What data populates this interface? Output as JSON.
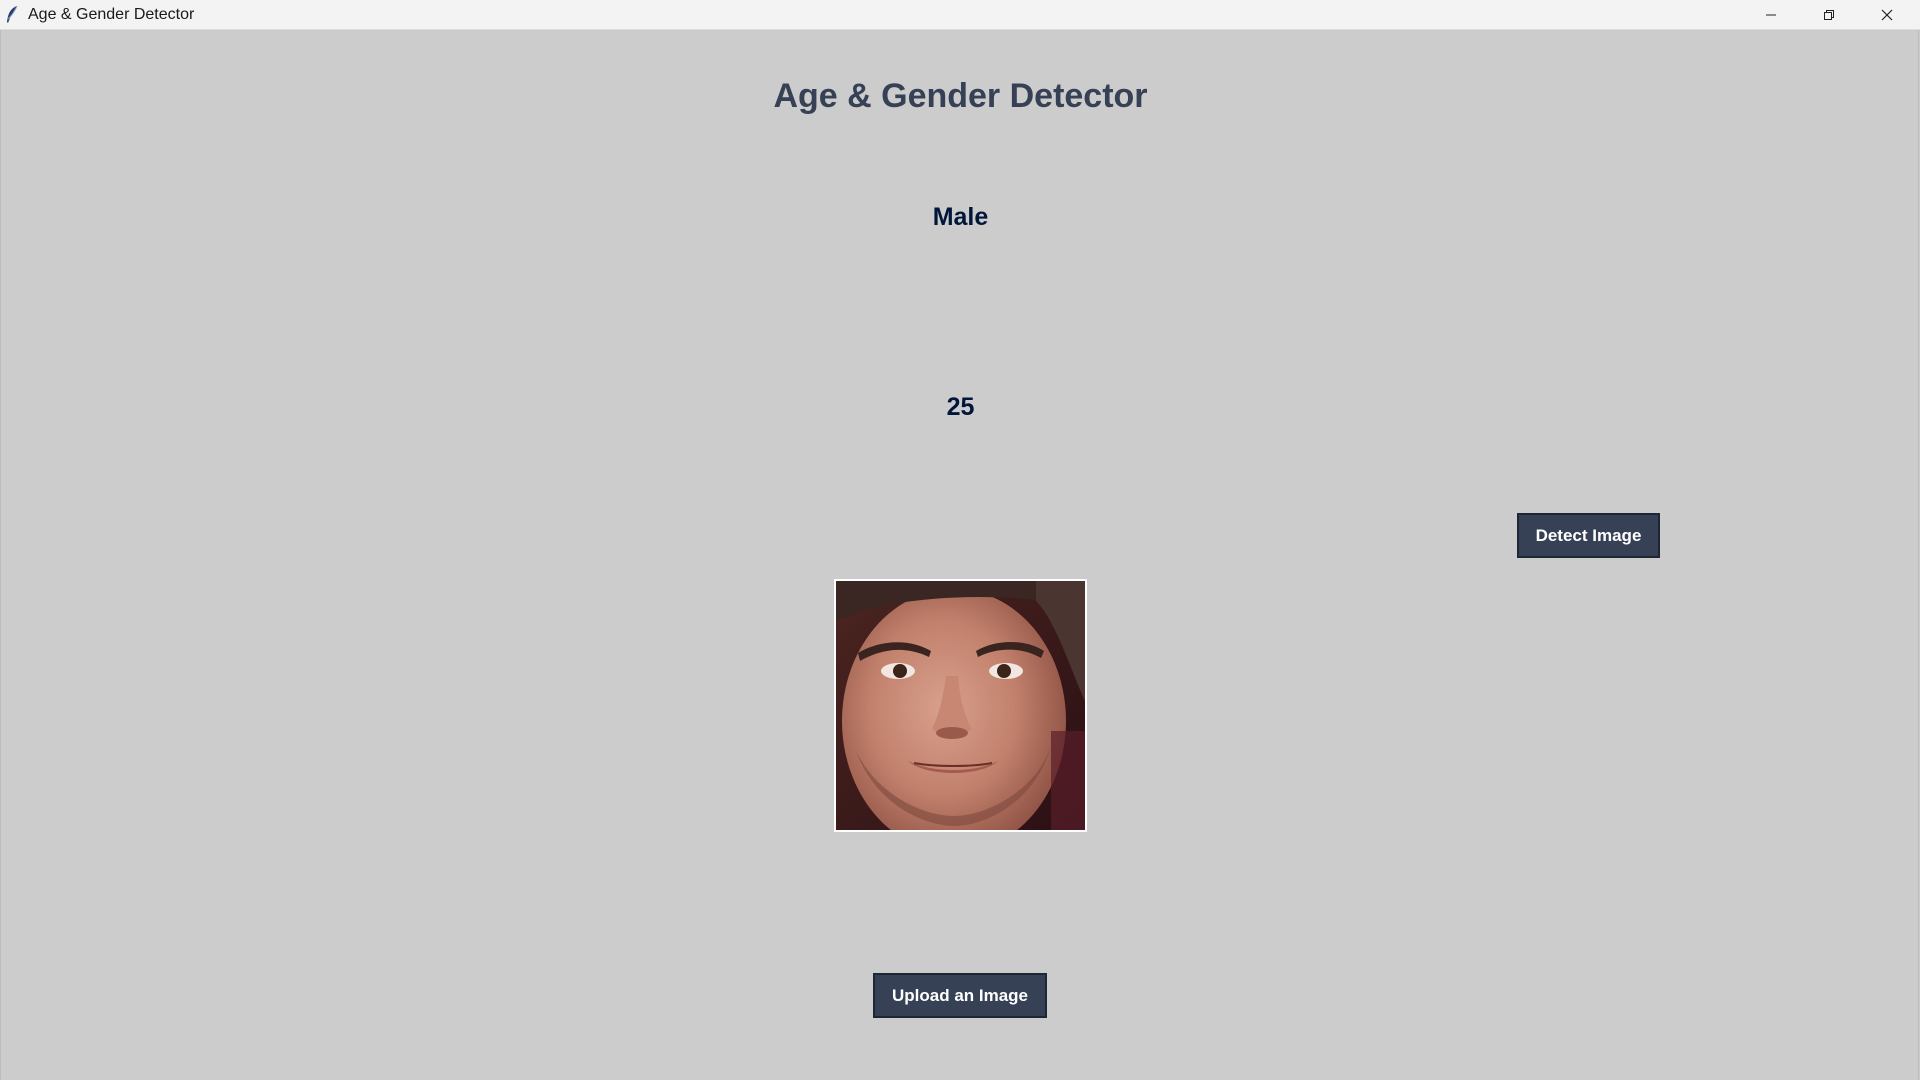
{
  "window": {
    "title": "Age & Gender Detector",
    "icon": "feather-icon",
    "controls": [
      "minimize-icon",
      "restore-icon",
      "close-icon"
    ]
  },
  "main": {
    "heading": "Age & Gender Detector",
    "gender_result": "Male",
    "age_result": "25",
    "detect_button_label": "Detect Image",
    "upload_button_label": "Upload an Image",
    "uploaded_image": "face-photo"
  },
  "colors": {
    "background": "#cccccc",
    "heading": "#364156",
    "result_text": "#011638",
    "button_bg": "#364156",
    "button_text": "#ffffff"
  }
}
